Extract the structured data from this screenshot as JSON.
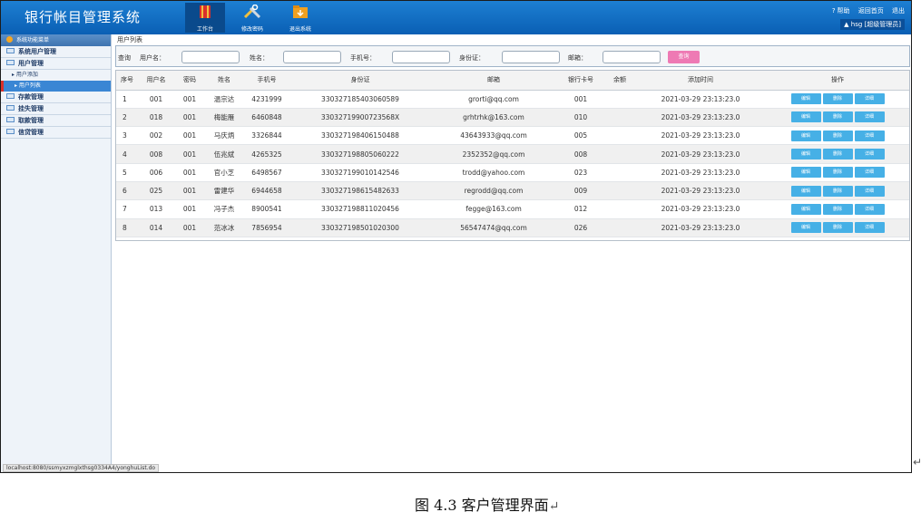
{
  "header": {
    "app_title": "银行帐目管理系统",
    "nav": [
      {
        "label": "工作台"
      },
      {
        "label": "修改密码"
      },
      {
        "label": "退出系统"
      }
    ],
    "top_links": [
      "帮助",
      "返回首页",
      "退出"
    ],
    "user_label": "hsg [超级管理员]"
  },
  "sidebar": {
    "title": "系统功能菜单",
    "items": [
      {
        "label": "系统用户管理"
      },
      {
        "label": "用户管理"
      },
      {
        "label": "存款管理"
      },
      {
        "label": "挂失管理"
      },
      {
        "label": "取款管理"
      },
      {
        "label": "信贷管理"
      }
    ],
    "subitems": [
      {
        "label": "用户添加"
      },
      {
        "label": "用户列表"
      }
    ]
  },
  "breadcrumb": "用户列表",
  "query": {
    "title": "查询",
    "fields": [
      {
        "label": "用户名：",
        "value": ""
      },
      {
        "label": "姓名：",
        "value": ""
      },
      {
        "label": "手机号：",
        "value": ""
      },
      {
        "label": "身份证：",
        "value": ""
      },
      {
        "label": "邮箱：",
        "value": ""
      }
    ],
    "button": "查询"
  },
  "table": {
    "headers": [
      "序号",
      "用户名",
      "密码",
      "姓名",
      "手机号",
      "身份证",
      "邮箱",
      "银行卡号",
      "余额",
      "添加时间",
      "操作"
    ],
    "actions": [
      "编辑",
      "删除",
      "详细"
    ],
    "rows": [
      [
        "1",
        "001",
        "001",
        "温宗达",
        "4231999",
        "330327185403060589",
        "grorti@qq.com",
        "001",
        "",
        "2021-03-29 23:13:23.0"
      ],
      [
        "2",
        "018",
        "001",
        "梅能雁",
        "6460848",
        "33032719900723568X",
        "grhtrhk@163.com",
        "010",
        "",
        "2021-03-29 23:13:23.0"
      ],
      [
        "3",
        "002",
        "001",
        "马庆炳",
        "3326844",
        "330327198406150488",
        "43643933@qq.com",
        "005",
        "",
        "2021-03-29 23:13:23.0"
      ],
      [
        "4",
        "008",
        "001",
        "伍兆斌",
        "4265325",
        "330327198805060222",
        "2352352@qq.com",
        "008",
        "",
        "2021-03-29 23:13:23.0"
      ],
      [
        "5",
        "006",
        "001",
        "官小芝",
        "6498567",
        "330327199010142546",
        "trodd@yahoo.com",
        "023",
        "",
        "2021-03-29 23:13:23.0"
      ],
      [
        "6",
        "025",
        "001",
        "雷建华",
        "6944658",
        "330327198615482633",
        "regrodd@qq.com",
        "009",
        "",
        "2021-03-29 23:13:23.0"
      ],
      [
        "7",
        "013",
        "001",
        "冯子杰",
        "8900541",
        "330327198811020456",
        "fegge@163.com",
        "012",
        "",
        "2021-03-29 23:13:23.0"
      ],
      [
        "8",
        "014",
        "001",
        "范冰冰",
        "7856954",
        "330327198501020300",
        "56547474@qq.com",
        "026",
        "",
        "2021-03-29 23:13:23.0"
      ]
    ]
  },
  "status_bar": "localhost:8080/ssmyxzmglxthsg0334A4/yonghuList.do",
  "caption": "图 4.3 客户管理界面",
  "colors": {
    "header": "#0a5fb4",
    "action_button": "#46b0e6",
    "query_button": "#ee7ab4",
    "active_menu": "#3a86d4"
  }
}
